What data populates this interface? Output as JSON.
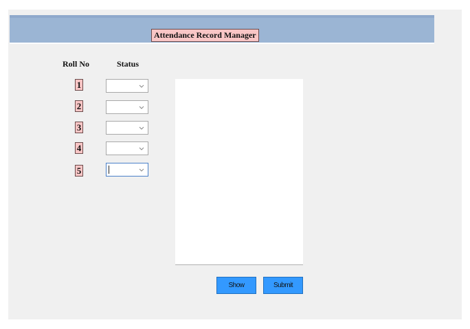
{
  "app": {
    "title": "Attendance Record Manager"
  },
  "table": {
    "roll_header": "Roll No",
    "status_header": "Status",
    "rows": [
      {
        "roll": "1",
        "status": ""
      },
      {
        "roll": "2",
        "status": ""
      },
      {
        "roll": "3",
        "status": ""
      },
      {
        "roll": "4",
        "status": ""
      },
      {
        "roll": "5",
        "status": ""
      }
    ],
    "focused_row": "5"
  },
  "output": {
    "text": ""
  },
  "buttons": {
    "show_label": "Show",
    "submit_label": "Submit"
  },
  "icons": {
    "dropdown": "chevron-down-icon"
  },
  "colors": {
    "header_bar": "#9bb5d4",
    "label_bg": "#f9c6c6",
    "button_bg": "#3399ff",
    "window_bg": "#f0f0f0"
  }
}
